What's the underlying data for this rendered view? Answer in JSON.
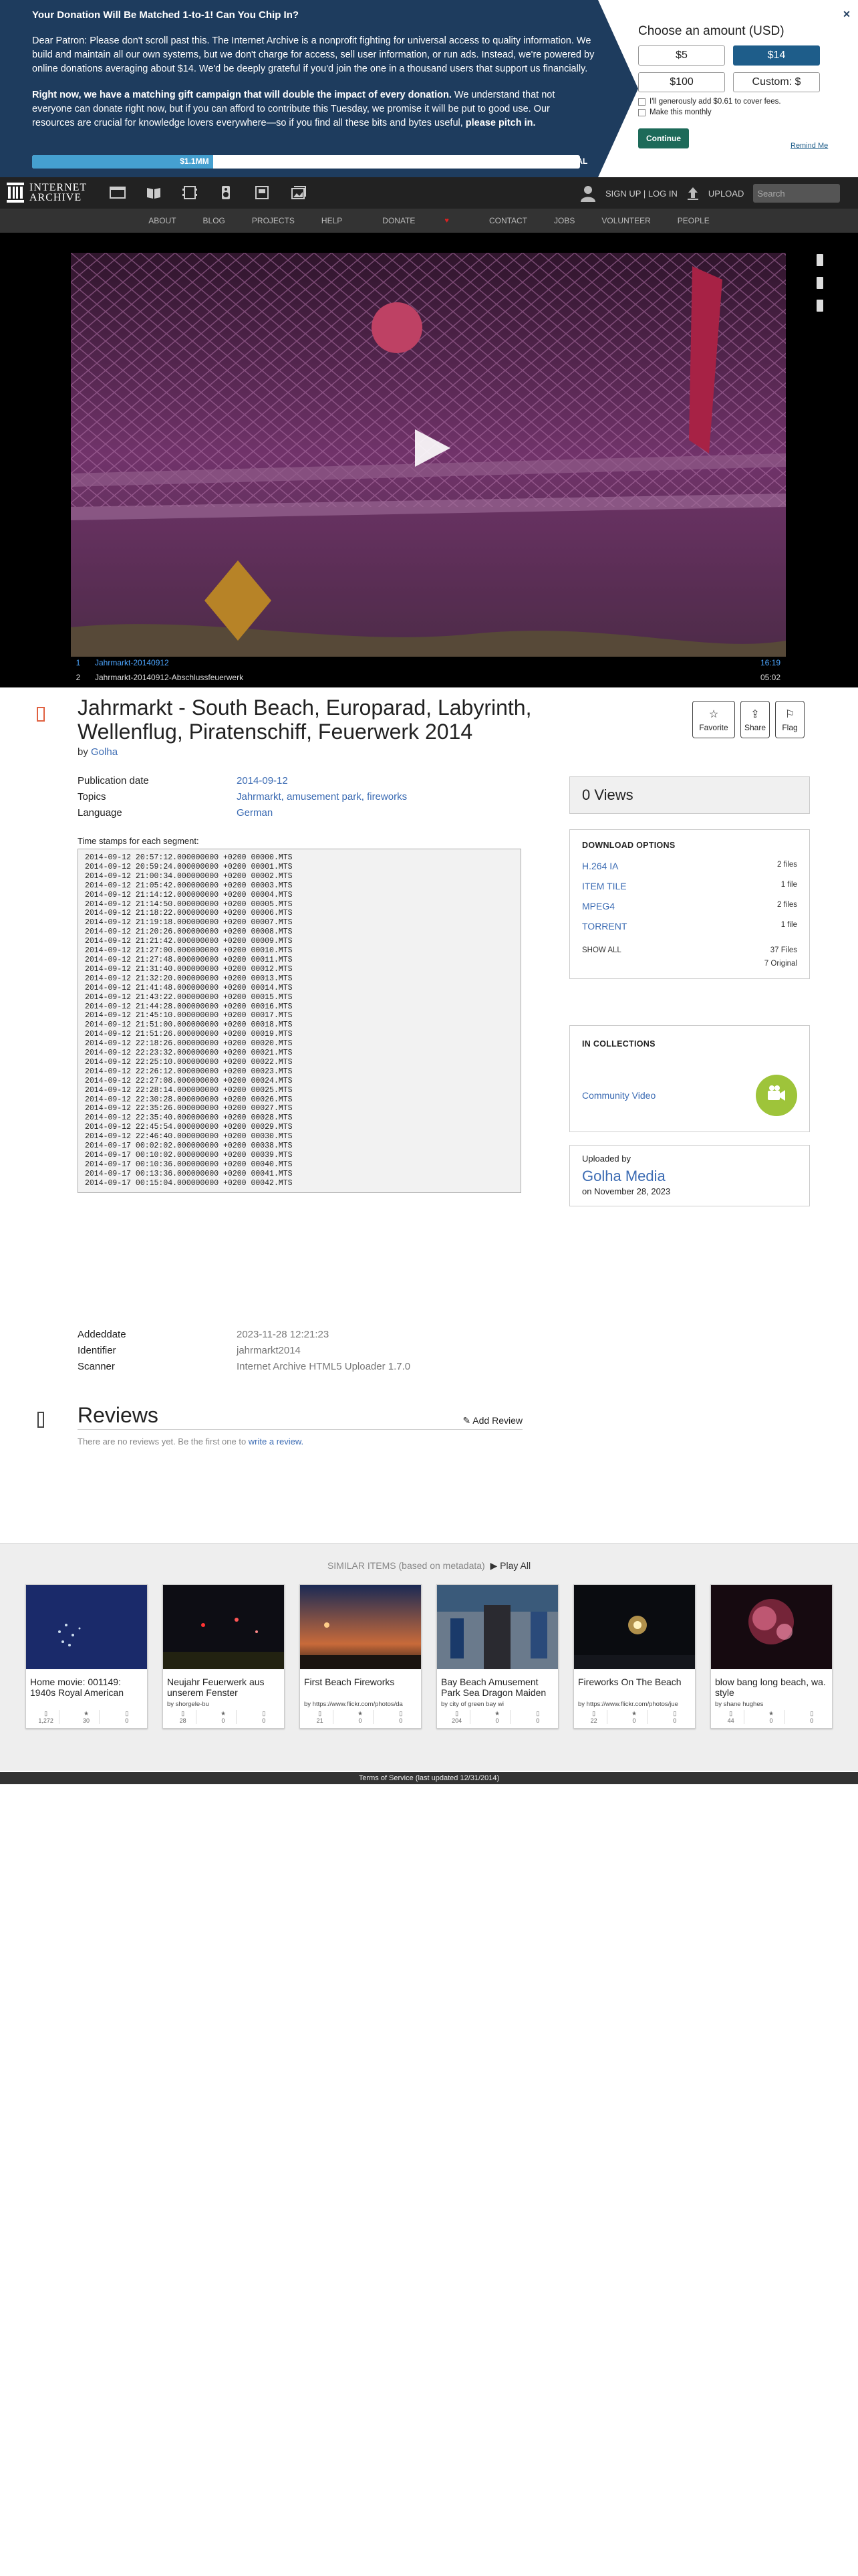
{
  "donation": {
    "heading": "Your Donation Will Be Matched 1-to-1! Can You Chip In?",
    "para1": "Dear Patron: Please don't scroll past this. The Internet Archive is a nonprofit fighting for universal access to quality information. We build and maintain all our own systems, but we don't charge for access, sell user information, or run ads. Instead, we're powered by online donations averaging about $14. We'd be deeply grateful if you'd join the one in a thousand users that support us financially.",
    "para2_bold": "Right now, we have a matching gift campaign that will double the impact of every donation.",
    "para2_rest": " We understand that not everyone can donate right now, but if you can afford to contribute this Tuesday, we promise it will be put to good use. Our resources are crucial for knowledge lovers everywhere—so if you find all these bits and bytes useful, ",
    "para2_end": "please pitch in.",
    "progress_label": "$1.1MM",
    "progress_fraction": 0.33,
    "goal_label": "$3MM GOAL",
    "panel_title": "Choose an amount (USD)",
    "amounts": [
      "$5",
      "$14",
      "$100",
      "Custom: $"
    ],
    "fee_label": "I'll generously add $0.61 to cover fees.",
    "monthly_label": "Make this monthly",
    "continue_label": "Continue",
    "remind_label": "Remind Me",
    "close_label": "✕"
  },
  "topbar": {
    "logo_line1": "INTERNET",
    "logo_line2": "ARCHIVE",
    "signup_label": "SIGN UP | LOG IN",
    "upload_label": "UPLOAD",
    "search_placeholder": "Search"
  },
  "nav": {
    "items": [
      "ABOUT",
      "BLOG",
      "PROJECTS",
      "HELP",
      "DONATE",
      "CONTACT",
      "JOBS",
      "VOLUNTEER",
      "PEOPLE"
    ]
  },
  "player": {
    "playlist": [
      {
        "num": "1",
        "title": "Jahrmarkt-20140912",
        "duration": "16:19"
      },
      {
        "num": "2",
        "title": "Jahrmarkt-20140912-Abschlussfeuerwerk",
        "duration": "05:02"
      }
    ]
  },
  "item": {
    "title": "Jahrmarkt - South Beach, Europarad, Labyrinth, Wellenflug, Piratenschiff, Feuerwerk 2014",
    "by_label": "by",
    "creator": "Golha",
    "buttons": {
      "favorite": "Favorite",
      "share": "Share",
      "flag": "Flag"
    },
    "meta": {
      "pubdate_label": "Publication date",
      "pubdate": "2014-09-12",
      "topics_label": "Topics",
      "topics": "Jahrmarkt, amusement park, fireworks",
      "language_label": "Language",
      "language": "German"
    },
    "segments_label": "Time stamps for each segment:",
    "segments": [
      "2014-09-12 20:57:12.000000000 +0200 00000.MTS",
      "2014-09-12 20:59:24.000000000 +0200 00001.MTS",
      "2014-09-12 21:00:34.000000000 +0200 00002.MTS",
      "2014-09-12 21:05:42.000000000 +0200 00003.MTS",
      "2014-09-12 21:14:12.000000000 +0200 00004.MTS",
      "2014-09-12 21:14:50.000000000 +0200 00005.MTS",
      "2014-09-12 21:18:22.000000000 +0200 00006.MTS",
      "2014-09-12 21:19:18.000000000 +0200 00007.MTS",
      "2014-09-12 21:20:26.000000000 +0200 00008.MTS",
      "2014-09-12 21:21:42.000000000 +0200 00009.MTS",
      "2014-09-12 21:27:00.000000000 +0200 00010.MTS",
      "2014-09-12 21:27:48.000000000 +0200 00011.MTS",
      "2014-09-12 21:31:40.000000000 +0200 00012.MTS",
      "2014-09-12 21:32:20.000000000 +0200 00013.MTS",
      "2014-09-12 21:41:48.000000000 +0200 00014.MTS",
      "2014-09-12 21:43:22.000000000 +0200 00015.MTS",
      "2014-09-12 21:44:28.000000000 +0200 00016.MTS",
      "2014-09-12 21:45:10.000000000 +0200 00017.MTS",
      "2014-09-12 21:51:00.000000000 +0200 00018.MTS",
      "2014-09-12 21:51:26.000000000 +0200 00019.MTS",
      "2014-09-12 22:18:26.000000000 +0200 00020.MTS",
      "2014-09-12 22:23:32.000000000 +0200 00021.MTS",
      "2014-09-12 22:25:10.000000000 +0200 00022.MTS",
      "2014-09-12 22:26:12.000000000 +0200 00023.MTS",
      "2014-09-12 22:27:08.000000000 +0200 00024.MTS",
      "2014-09-12 22:28:14.000000000 +0200 00025.MTS",
      "2014-09-12 22:30:28.000000000 +0200 00026.MTS",
      "2014-09-12 22:35:26.000000000 +0200 00027.MTS",
      "2014-09-12 22:35:40.000000000 +0200 00028.MTS",
      "2014-09-12 22:45:54.000000000 +0200 00029.MTS",
      "2014-09-12 22:46:40.000000000 +0200 00030.MTS",
      "2014-09-17 00:02:02.000000000 +0200 00038.MTS",
      "2014-09-17 00:10:02.000000000 +0200 00039.MTS",
      "2014-09-17 00:10:36.000000000 +0200 00040.MTS",
      "2014-09-17 00:13:36.000000000 +0200 00041.MTS",
      "2014-09-17 00:15:04.000000000 +0200 00042.MTS"
    ],
    "meta2": {
      "addeddate_label": "Addeddate",
      "addeddate": "2023-11-28 12:21:23",
      "identifier_label": "Identifier",
      "identifier": "jahrmarkt2014",
      "scanner_label": "Scanner",
      "scanner": "Internet Archive HTML5 Uploader 1.7.0"
    }
  },
  "sidebar": {
    "views": "0 Views",
    "download_title": "DOWNLOAD OPTIONS",
    "formats": [
      {
        "name": "H.264 IA",
        "count": "2 files"
      },
      {
        "name": "ITEM TILE",
        "count": "1 file"
      },
      {
        "name": "MPEG4",
        "count": "2 files"
      },
      {
        "name": "TORRENT",
        "count": "1 file"
      }
    ],
    "show_all": "SHOW ALL",
    "total_files": "37 Files",
    "original": "7 Original",
    "collections_title": "IN COLLECTIONS",
    "collection": "Community Video",
    "uploaded_by_label": "Uploaded by",
    "uploader": "Golha Media",
    "uploaded_on": "on November 28, 2023"
  },
  "reviews": {
    "title": "Reviews",
    "add_label": "Add Review",
    "none_text": "There are no reviews yet. Be the first one to ",
    "write_link": "write a review."
  },
  "similar": {
    "heading": "SIMILAR ITEMS (based on metadata)",
    "play_all": "Play All",
    "items": [
      {
        "title": "Home movie: 001149: 1940s Royal American",
        "by": "",
        "views": "1,272",
        "favs": "30",
        "reviews": "0"
      },
      {
        "title": "Neujahr Feuerwerk aus unserem Fenster",
        "by": "by shorgele-bu",
        "views": "28",
        "favs": "0",
        "reviews": "0"
      },
      {
        "title": "First Beach Fireworks",
        "by": "by https://www.flickr.com/photos/da",
        "views": "21",
        "favs": "0",
        "reviews": "0"
      },
      {
        "title": "Bay Beach Amusement Park Sea Dragon Maiden",
        "by": "by city of green bay wi",
        "views": "204",
        "favs": "0",
        "reviews": "0"
      },
      {
        "title": "Fireworks On The Beach",
        "by": "by https://www.flickr.com/photos/jue",
        "views": "22",
        "favs": "0",
        "reviews": "0"
      },
      {
        "title": "blow bang long beach, wa. style",
        "by": "by shane hughes",
        "views": "44",
        "favs": "0",
        "reviews": "0"
      }
    ]
  },
  "footer": {
    "text": "Terms of Service (last updated 12/31/2014)"
  }
}
